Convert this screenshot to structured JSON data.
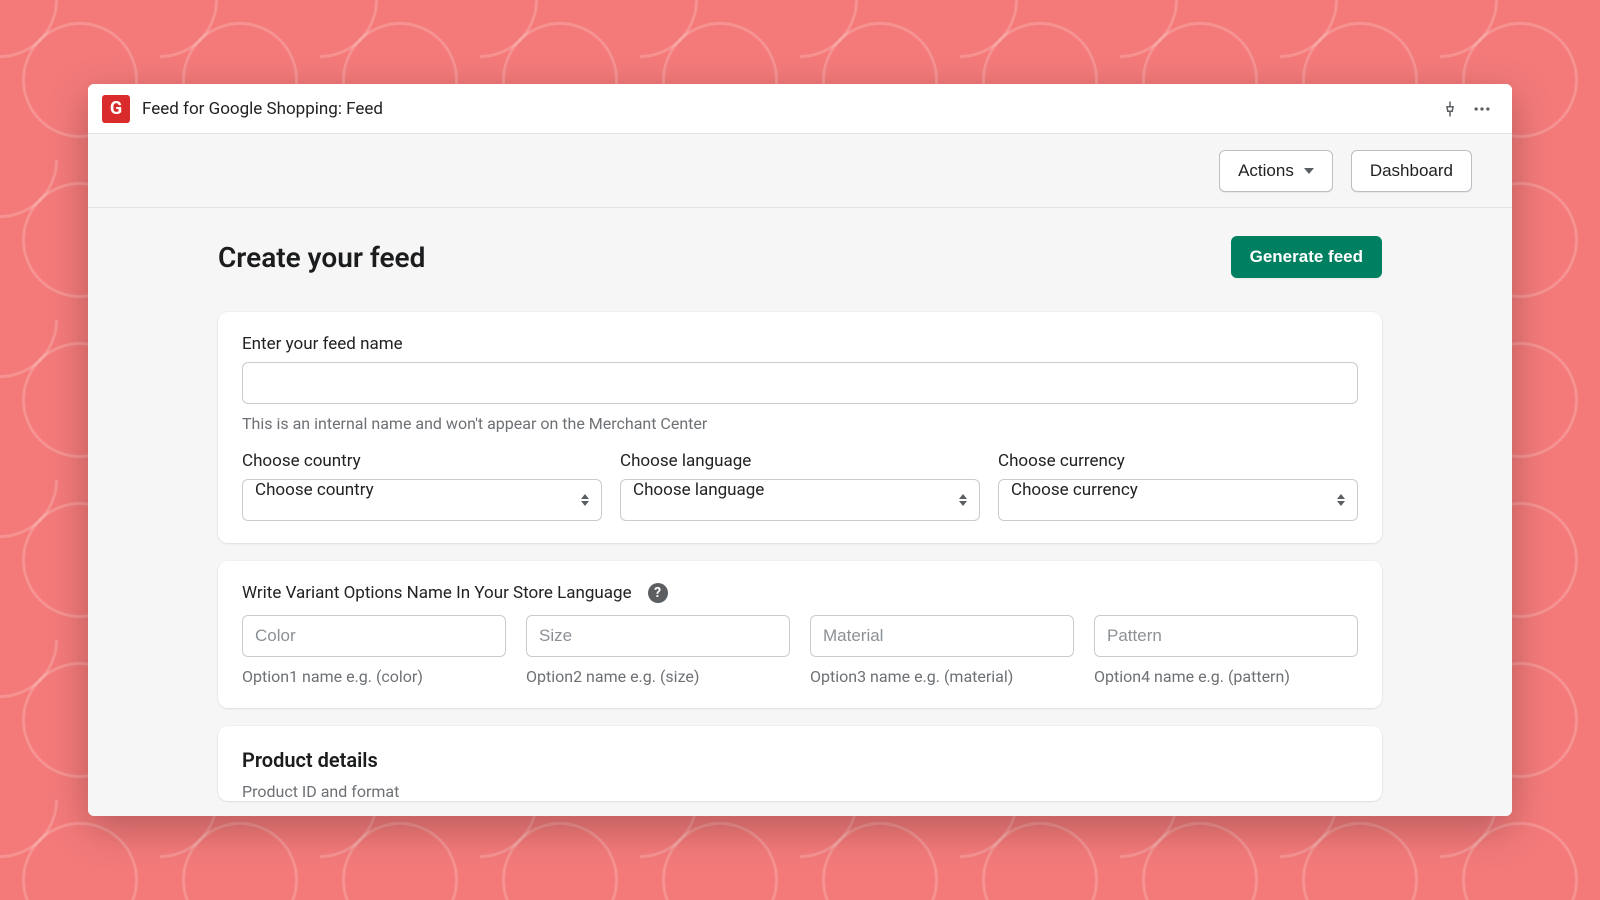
{
  "titlebar": {
    "app_icon_letter": "G",
    "title": "Feed for Google Shopping: Feed"
  },
  "toolbar": {
    "actions_label": "Actions",
    "dashboard_label": "Dashboard"
  },
  "page": {
    "title": "Create your feed",
    "generate_label": "Generate feed"
  },
  "feed_card": {
    "name_label": "Enter your feed name",
    "name_value": "",
    "name_help": "This is an internal name and won't appear on the Merchant Center",
    "country_label": "Choose country",
    "country_value": "Choose country",
    "language_label": "Choose language",
    "language_value": "Choose language",
    "currency_label": "Choose currency",
    "currency_value": "Choose currency"
  },
  "variant_card": {
    "heading": "Write Variant Options Name In Your Store Language",
    "options": [
      {
        "placeholder": "Color",
        "hint": "Option1 name e.g. (color)"
      },
      {
        "placeholder": "Size",
        "hint": "Option2 name e.g. (size)"
      },
      {
        "placeholder": "Material",
        "hint": "Option3 name e.g. (material)"
      },
      {
        "placeholder": "Pattern",
        "hint": "Option4 name e.g. (pattern)"
      }
    ]
  },
  "product_card": {
    "title": "Product details",
    "sub": "Product ID and format"
  }
}
